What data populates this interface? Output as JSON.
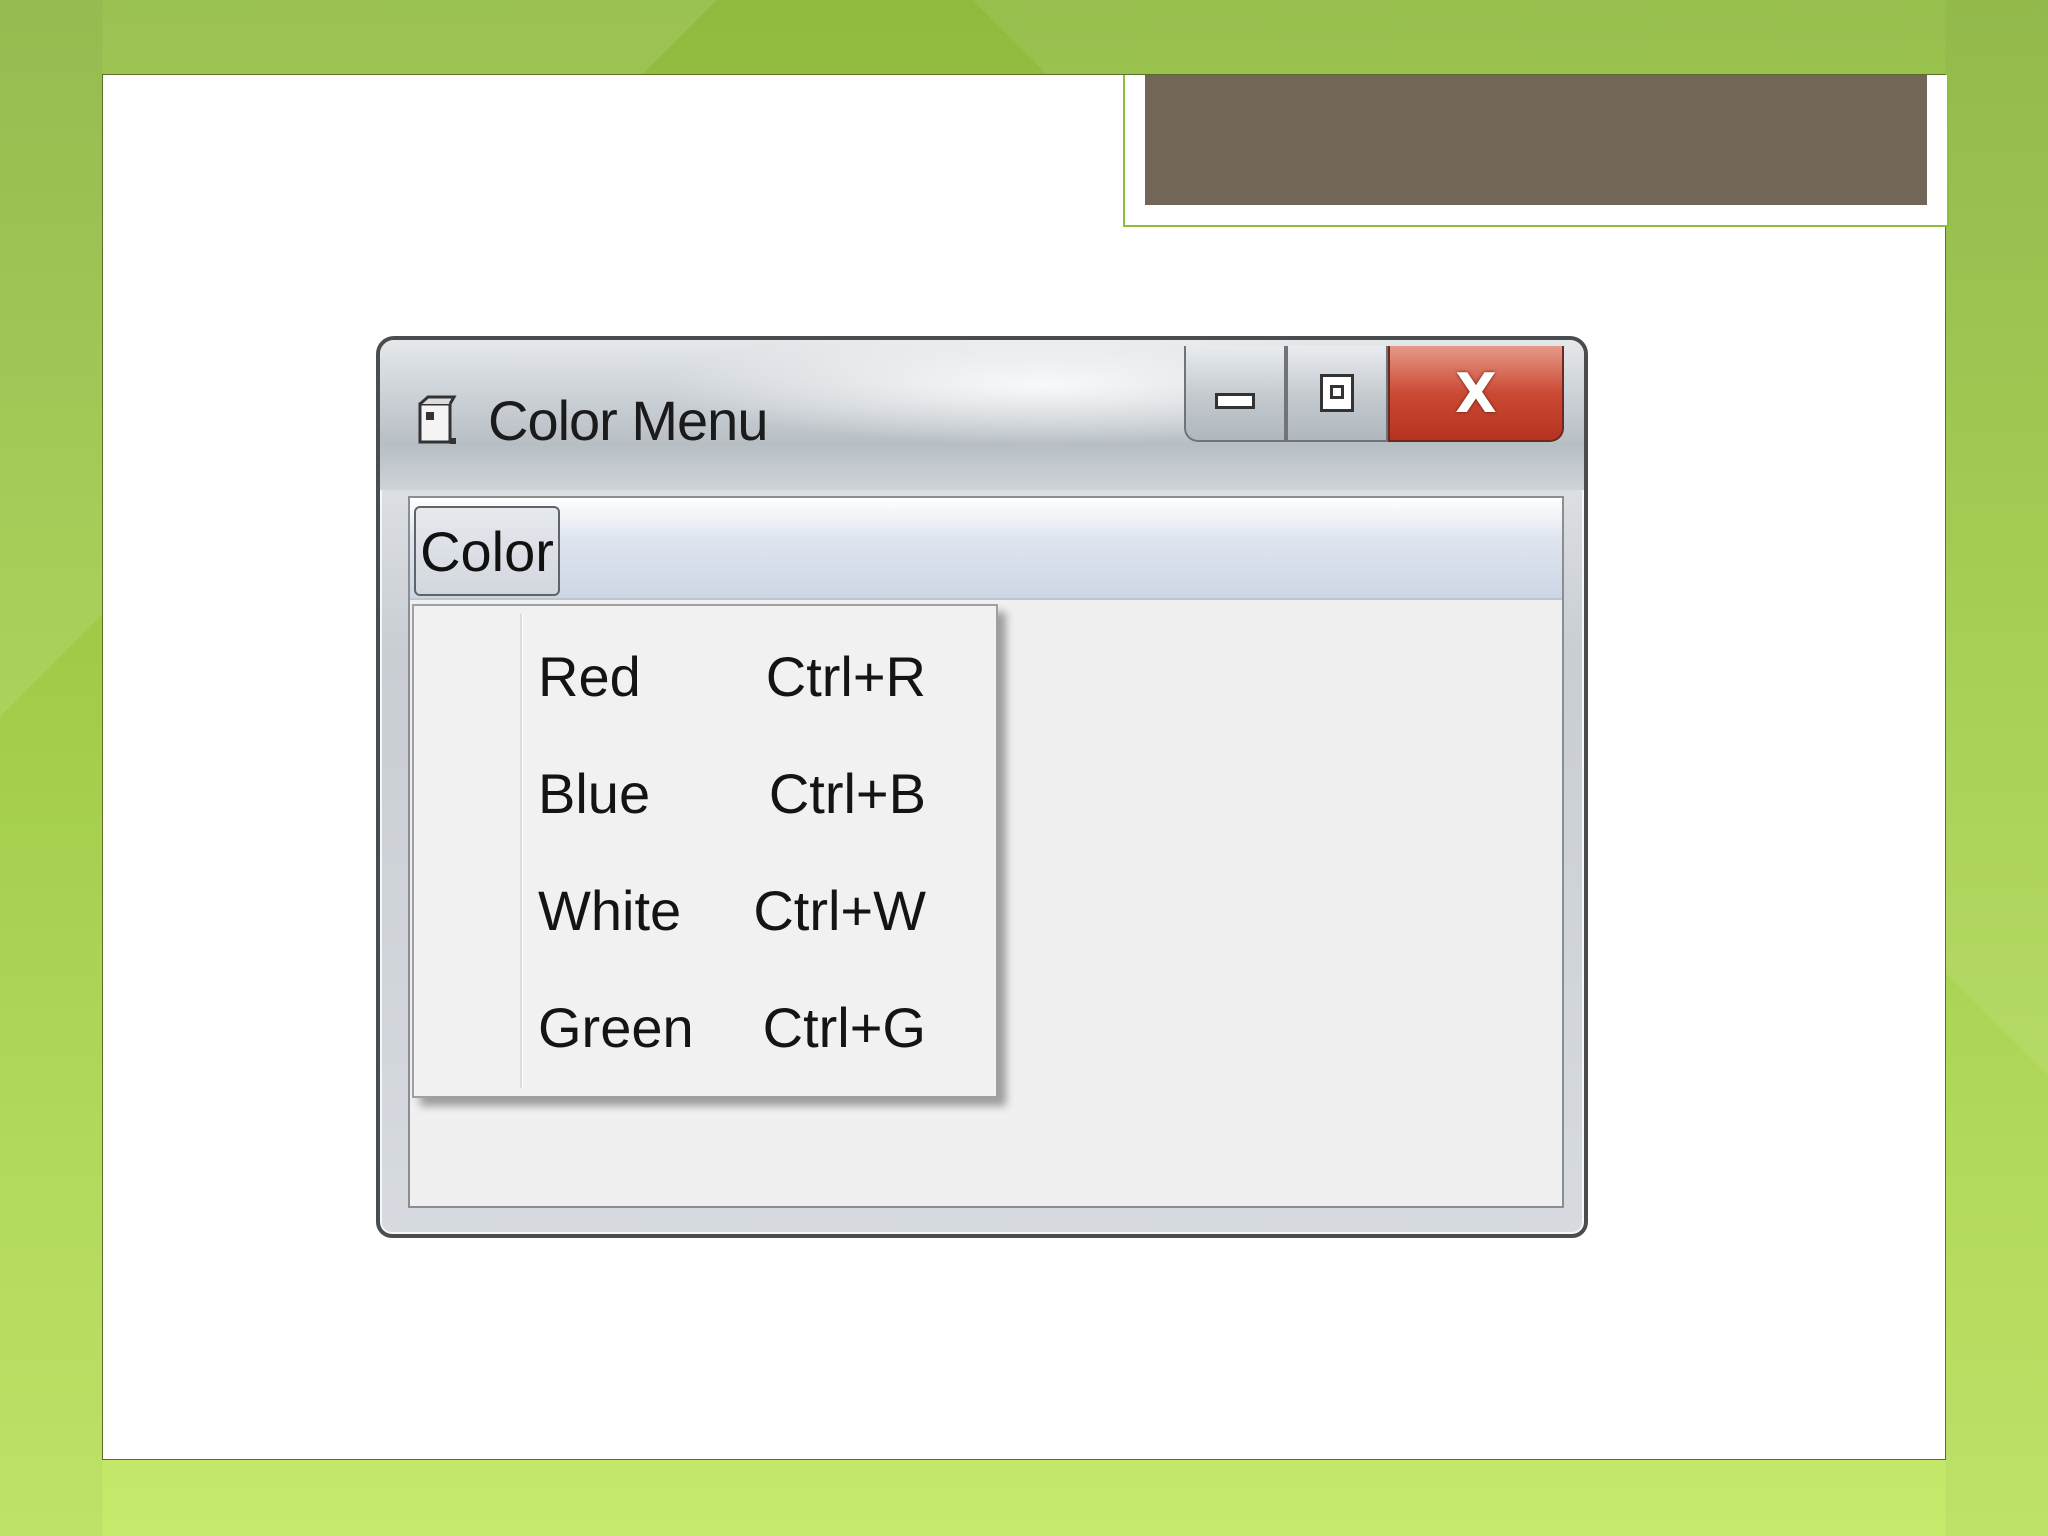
{
  "window": {
    "title": "Color Menu",
    "close_glyph": "X"
  },
  "menubar": {
    "items": [
      {
        "label": "Color"
      }
    ]
  },
  "dropdown": {
    "items": [
      {
        "label": "Red",
        "shortcut": "Ctrl+R"
      },
      {
        "label": "Blue",
        "shortcut": "Ctrl+B"
      },
      {
        "label": "White",
        "shortcut": "Ctrl+W"
      },
      {
        "label": "Green",
        "shortcut": "Ctrl+G"
      }
    ]
  },
  "colors": {
    "slide_background": "#a6d14a",
    "title_band": "#716657",
    "close_button": "#cc4a34"
  },
  "icons": {
    "app": "form-window-icon",
    "minimize": "minimize-icon",
    "maximize": "maximize-icon",
    "close": "close-icon"
  }
}
